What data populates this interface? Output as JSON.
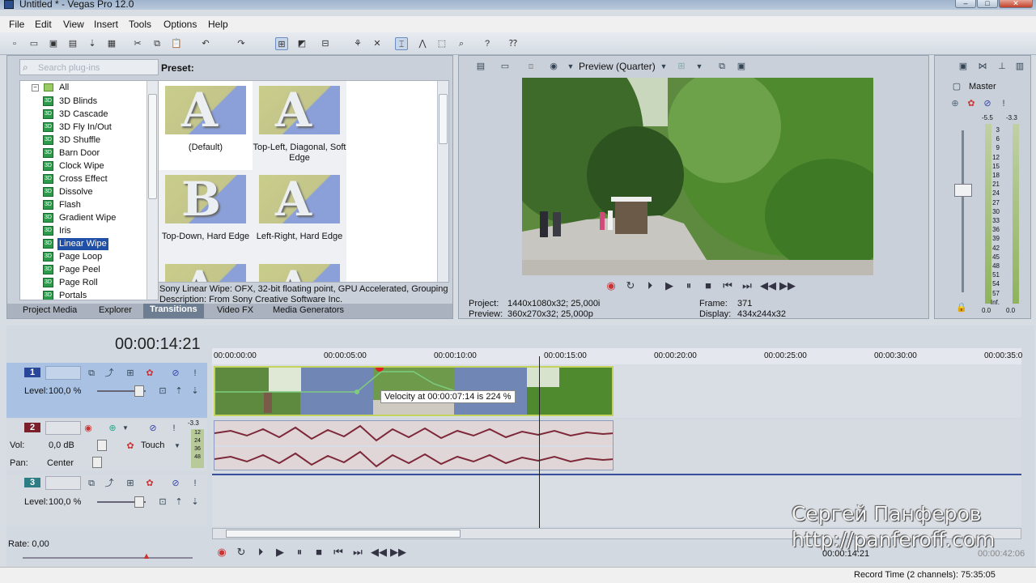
{
  "window": {
    "title": "Untitled * - Vegas Pro 12.0"
  },
  "menu": [
    "File",
    "Edit",
    "View",
    "Insert",
    "Tools",
    "Options",
    "Help"
  ],
  "explorer": {
    "search_placeholder": "Search plug-ins",
    "preset_label": "Preset:",
    "tree_root": "All",
    "tree_items": [
      "3D Blinds",
      "3D Cascade",
      "3D Fly In/Out",
      "3D Shuffle",
      "Barn Door",
      "Clock Wipe",
      "Cross Effect",
      "Dissolve",
      "Flash",
      "Gradient Wipe",
      "Iris",
      "Linear Wipe",
      "Page Loop",
      "Page Peel",
      "Page Roll",
      "Portals"
    ],
    "selected_item": "Linear Wipe",
    "presets": [
      {
        "label": "(Default)",
        "glyph": "A"
      },
      {
        "label": "Top-Left, Diagonal, Soft Edge",
        "glyph": "A"
      },
      {
        "label": "Top-Down, Hard Edge",
        "glyph": "B"
      },
      {
        "label": "Left-Right, Hard Edge",
        "glyph": "A"
      },
      {
        "label": "",
        "glyph": "A"
      },
      {
        "label": "",
        "glyph": "A"
      }
    ],
    "description_line1": "Sony Linear Wipe: OFX, 32-bit floating point, GPU Accelerated, Grouping S",
    "description_line2": "Description: From Sony Creative Software Inc.",
    "tabs": [
      "Project Media",
      "Explorer",
      "Transitions",
      "Video FX",
      "Media Generators"
    ],
    "active_tab": "Transitions"
  },
  "preview": {
    "quality": "Preview (Quarter)",
    "project_label": "Project:",
    "project_value": "1440x1080x32; 25,000i",
    "preview_label": "Preview:",
    "preview_value": "360x270x32; 25,000p",
    "frame_label": "Frame:",
    "frame_value": "371",
    "display_label": "Display:",
    "display_value": "434x244x32"
  },
  "master": {
    "title": "Master",
    "peak_left": "-5.5",
    "peak_right": "-3.3",
    "scale": [
      "3",
      "6",
      "9",
      "12",
      "15",
      "18",
      "21",
      "24",
      "27",
      "30",
      "33",
      "36",
      "39",
      "42",
      "45",
      "48",
      "51",
      "54",
      "57",
      "Inf."
    ],
    "bottom_left": "0.0",
    "bottom_right": "0.0"
  },
  "timeline": {
    "timecode": "00:00:14:21",
    "ruler": [
      "00:00:00:00",
      "00:00:05:00",
      "00:00:10:00",
      "00:00:15:00",
      "00:00:20:00",
      "00:00:25:00",
      "00:00:30:00",
      "00:00:35:0"
    ],
    "tracks": [
      {
        "number": "1",
        "type": "video",
        "level_label": "Level:",
        "level": "100,0 %"
      },
      {
        "number": "2",
        "type": "audio",
        "vol_label": "Vol:",
        "vol": "0,0 dB",
        "touch": "Touch",
        "pan_label": "Pan:",
        "pan": "Center",
        "meter_top": "-3.3",
        "meter_scale": [
          "12",
          "24",
          "36",
          "48"
        ]
      },
      {
        "number": "3",
        "type": "video",
        "level_label": "Level:",
        "level": "100,0 %"
      }
    ],
    "tooltip": "Velocity at 00:00:07:14 is 224 %",
    "rate": "Rate: 0,00",
    "cursor_time": "00:00:14:21",
    "end_time": "00:00:42:06"
  },
  "watermark": {
    "name": "Сергей Панферов",
    "url": "http://panferoff.com"
  },
  "status": {
    "record_time": "Record Time (2 channels): 75:35:05"
  }
}
